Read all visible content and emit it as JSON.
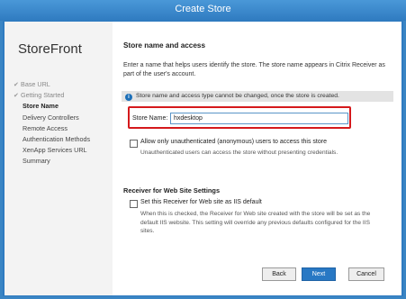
{
  "window": {
    "title": "Create Store"
  },
  "sidebar": {
    "brand": "StoreFront",
    "items": [
      {
        "label": "Base URL",
        "state": "done"
      },
      {
        "label": "Getting Started",
        "state": "done"
      },
      {
        "label": "Store Name",
        "state": "active"
      },
      {
        "label": "Delivery Controllers",
        "state": "pending"
      },
      {
        "label": "Remote Access",
        "state": "pending"
      },
      {
        "label": "Authentication Methods",
        "state": "pending"
      },
      {
        "label": "XenApp Services URL",
        "state": "pending"
      },
      {
        "label": "Summary",
        "state": "pending"
      }
    ]
  },
  "main": {
    "heading": "Store name and access",
    "description": "Enter a name that helps users identify the store. The store name appears in Citrix Receiver as part of the user's account.",
    "info_text": "Store name and access type cannot be changed, once the store is created.",
    "store_name_label": "Store Name:",
    "store_name_value": "hxdesktop",
    "unauth_checkbox_label": "Allow only unauthenticated (anonymous) users to access this store",
    "unauth_help": "Unauthenticated users can access the store without presenting credentials.",
    "receiver_heading": "Receiver for Web Site Settings",
    "iis_checkbox_label": "Set this Receiver for Web site as IIS default",
    "iis_help": "When this is checked, the Receiver for Web site created with the store will be set as the default IIS website. This setting will override any previous defaults configured for the IIS sites."
  },
  "buttons": {
    "back": "Back",
    "next": "Next",
    "cancel": "Cancel"
  },
  "colors": {
    "accent": "#2878c4",
    "highlight": "#d5191c"
  }
}
